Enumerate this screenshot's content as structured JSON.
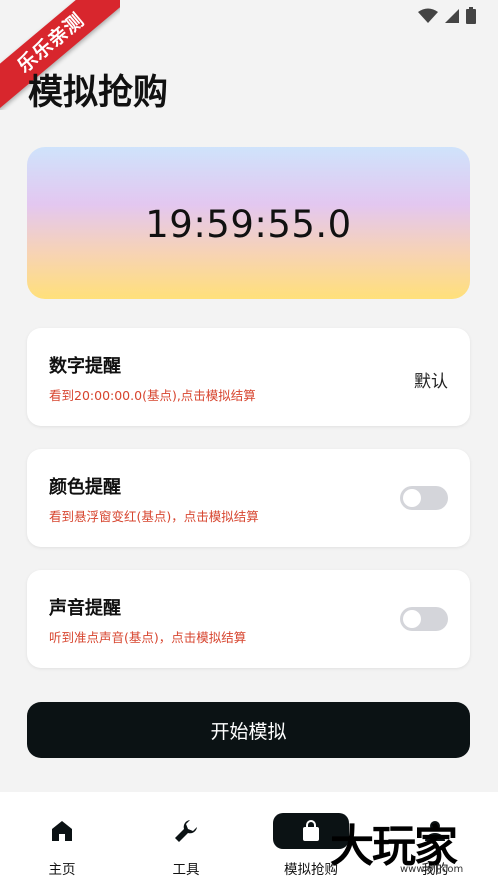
{
  "ribbon": {
    "text": "乐乐亲测"
  },
  "page": {
    "title": "模拟抢购"
  },
  "timer": {
    "value": "19:59:55.0"
  },
  "cards": [
    {
      "title": "数字提醒",
      "subtitle": "看到20:00:00.0(基点),点击模拟结算",
      "right_text": "默认"
    },
    {
      "title": "颜色提醒",
      "subtitle": "看到悬浮窗变红(基点)，点击模拟结算",
      "toggle_on": false
    },
    {
      "title": "声音提醒",
      "subtitle": "听到准点声音(基点)，点击模拟结算",
      "toggle_on": false
    }
  ],
  "start_button": {
    "label": "开始模拟"
  },
  "nav": {
    "items": [
      {
        "label": "主页",
        "icon": "home-icon"
      },
      {
        "label": "工具",
        "icon": "wrench-icon"
      },
      {
        "label": "模拟抢购",
        "icon": "shopping-bag-icon",
        "active": true
      },
      {
        "label": "我的",
        "icon": "user-icon"
      }
    ]
  },
  "watermark": {
    "text": "大玩家",
    "sub": "www.6ll.com"
  },
  "colors": {
    "accent_dark": "#0b1214",
    "subtitle_red": "#d7452f",
    "ribbon_red": "#d8262d"
  }
}
